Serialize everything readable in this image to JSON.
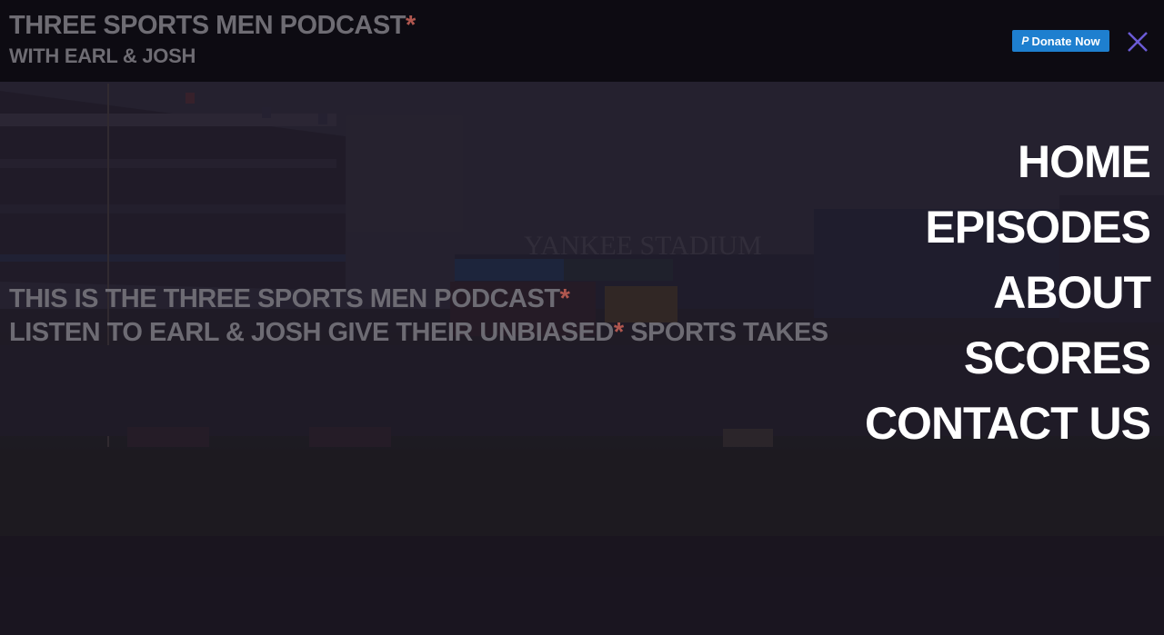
{
  "header": {
    "title": "THREE SPORTS MEN PODCAST",
    "title_asterisk": "*",
    "subtitle": "WITH EARL & JOSH",
    "donate_label": "Donate Now",
    "donate_icon": "P",
    "close_icon": "close-icon"
  },
  "hero": {
    "line1": "THIS IS THE THREE SPORTS MEN PODCAST",
    "line1_asterisk": "*",
    "line2_a": "LISTEN TO EARL & JOSH GIVE THEIR UNBIASED",
    "line2_asterisk": "*",
    "line2_b": " SPORTS TAKES",
    "background_text": "YANKEE STADIUM"
  },
  "nav": {
    "items": [
      {
        "label": "HOME"
      },
      {
        "label": "EPISODES"
      },
      {
        "label": "ABOUT"
      },
      {
        "label": "SCORES"
      },
      {
        "label": "CONTACT US"
      }
    ]
  },
  "colors": {
    "accent_asterisk": "#b0574f",
    "donate_bg": "#1e7fcf",
    "close_icon": "#6b5bd6",
    "header_bg": "#0d0b12",
    "muted_text": "#6e6c73"
  }
}
